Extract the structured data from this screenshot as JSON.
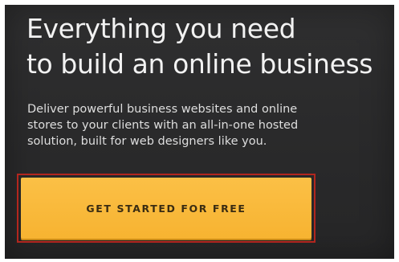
{
  "hero": {
    "headline_line1": "Everything you need",
    "headline_line2": "to build an online business",
    "subtext_line1": "Deliver powerful business websites and online",
    "subtext_line2": "stores to your clients with an all-in-one hosted",
    "subtext_line3": "solution, built for web designers like you.",
    "cta_label": "GET STARTED FOR FREE"
  },
  "colors": {
    "background": "#2b2b2c",
    "cta": "#f8b737",
    "highlight_border": "#b3261e",
    "text": "#f2f2f2"
  }
}
